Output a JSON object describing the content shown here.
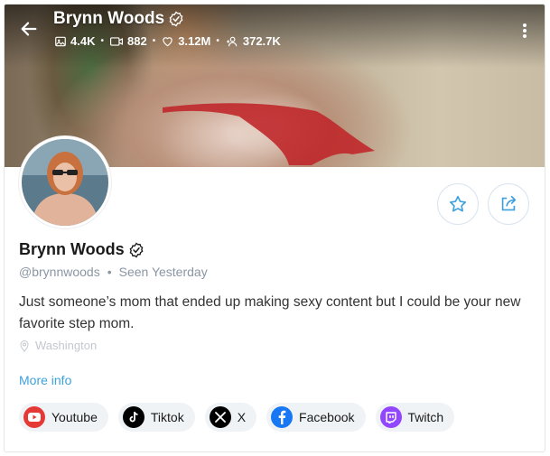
{
  "profile": {
    "name": "Brynn Woods",
    "handle": "@brynnwoods",
    "seen_label": "Seen",
    "seen_value": "Yesterday",
    "bio": "Just someone’s mom that ended up making sexy content but I could be your new favorite step mom.",
    "location": "Washington",
    "more_info": "More info"
  },
  "stats": {
    "photos": "4.4K",
    "videos": "882",
    "likes": "3.12M",
    "fans": "372.7K"
  },
  "socials": [
    {
      "label": "Youtube",
      "color": "#e53935"
    },
    {
      "label": "Tiktok",
      "color": "#000000"
    },
    {
      "label": "X",
      "color": "#000000"
    },
    {
      "label": "Facebook",
      "color": "#1877f2"
    },
    {
      "label": "Twitch",
      "color": "#9146ff"
    }
  ],
  "colors": {
    "accent": "#3ea0dd",
    "muted": "#8a96a3"
  }
}
